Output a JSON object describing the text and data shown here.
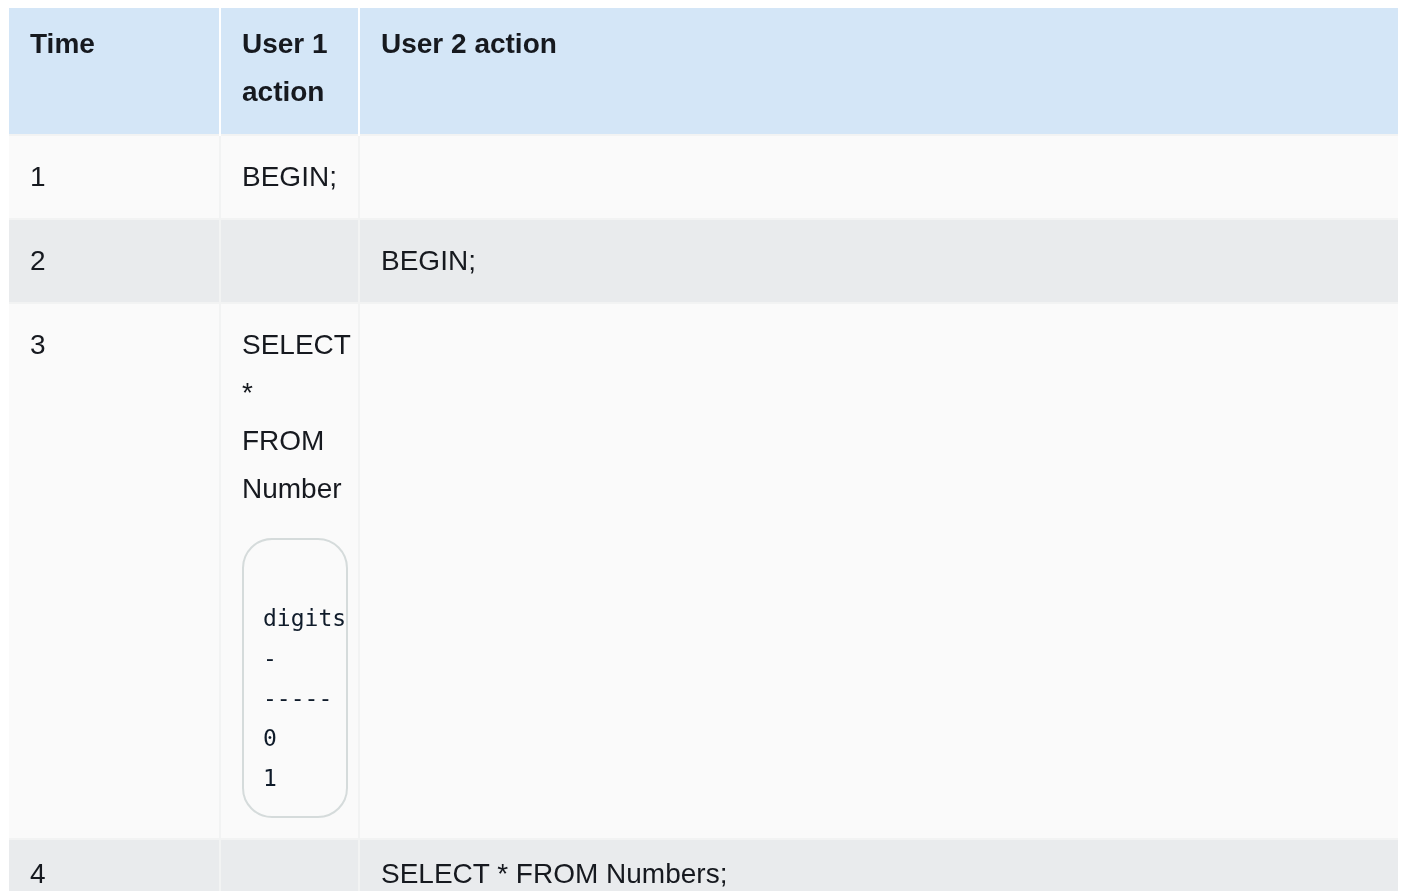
{
  "table": {
    "columns": [
      "Time",
      "User 1 action",
      "User 2 action"
    ],
    "rows": [
      {
        "time": "1",
        "user_1_action": "BEGIN;"
      },
      {
        "time": "2",
        "user_2_action": "BEGIN;"
      },
      {
        "time": "3",
        "user_1_action": "SELECT * FROM Number",
        "user_1_output": [
          "digits",
          "-",
          "-----",
          "0",
          "1"
        ]
      },
      {
        "time": "4",
        "user_2_action": "SELECT * FROM Numbers;"
      }
    ]
  }
}
